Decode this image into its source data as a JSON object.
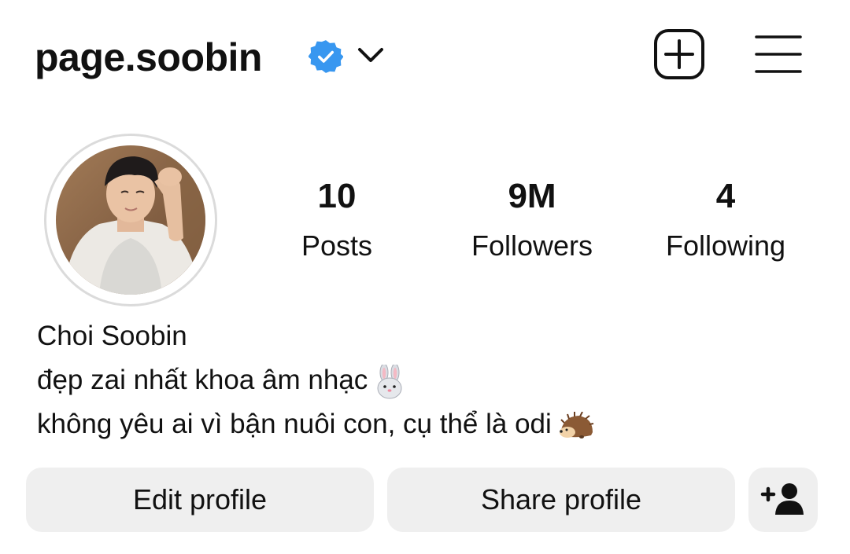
{
  "header": {
    "username": "page.soobin",
    "verified_icon": "verified-badge-icon",
    "verified_color": "#3897f0",
    "dropdown_icon": "chevron-down-icon",
    "create_icon": "plus-square-icon",
    "menu_icon": "hamburger-menu-icon"
  },
  "stats": {
    "posts": {
      "value": "10",
      "label": "Posts"
    },
    "followers": {
      "value": "9M",
      "label": "Followers"
    },
    "following": {
      "value": "4",
      "label": "Following"
    }
  },
  "profile": {
    "avatar": "profile-photo",
    "name": "Choi Soobin",
    "bio_line_1": "đẹp zai nhất khoa âm nhạc",
    "bio_line_1_emoji": "rabbit-face",
    "bio_line_2": "không yêu ai vì bận nuôi con, cụ thể là odi",
    "bio_line_2_emoji": "hedgehog"
  },
  "actions": {
    "edit_label": "Edit profile",
    "share_label": "Share profile",
    "discover_icon": "add-person-icon"
  }
}
